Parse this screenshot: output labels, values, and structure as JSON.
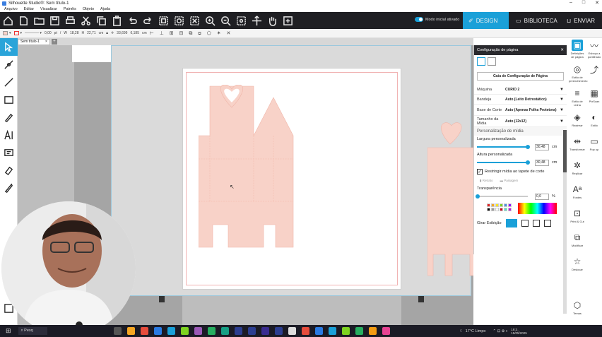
{
  "window": {
    "title": "Silhouette Studio®: Sem título-1",
    "controls": [
      "–",
      "□",
      "✕"
    ]
  },
  "menu": [
    "Arquivo",
    "Editar",
    "Visualizar",
    "Painéis",
    "Objeto",
    "Ajuda"
  ],
  "toolbar": {
    "mode_label": "Modo inicial ativado",
    "tabs": [
      {
        "label": "DESIGN",
        "icon": "design-icon",
        "active": true
      },
      {
        "label": "BIBLIOTECA",
        "icon": "folder-icon",
        "active": false
      },
      {
        "label": "ENVIAR",
        "icon": "send-icon",
        "active": false
      }
    ],
    "accent": "#1aa0d8",
    "dark": "#1f1f23"
  },
  "options_bar": {
    "line_width": "0,00",
    "line_unit": "pt",
    "w_label": "W",
    "w_value": "18,28",
    "h_label": "H",
    "h_value": "22,71",
    "size_unit": "cm",
    "x_value": "33,699",
    "y_value": "6,185",
    "pos_unit": "cm"
  },
  "document": {
    "tab_label": "Sem título-1",
    "close": "×",
    "add": "+"
  },
  "panel": {
    "title": "Configuração de página",
    "guide_button": "Guia de Configuração de Página",
    "rows": [
      {
        "label": "Máquina",
        "value": "CURIO 2"
      },
      {
        "label": "Bandeja",
        "value": "Auto (Leito Detrostático)"
      },
      {
        "label": "Base de Corte",
        "value": "Auto (Apenas Folha Protetora)"
      },
      {
        "label": "Tamanho da Mídia",
        "value": "Auto (12x12)"
      }
    ],
    "section_media": "Personalização de mídia",
    "width_label": "Largura personalizada",
    "width_value": "30,48",
    "height_label": "Altura personalizada",
    "height_value": "30,48",
    "unit": "cm",
    "width_fraction": 1.0,
    "height_fraction": 1.0,
    "restrict_label": "Restringir mídia ao tapete de corte",
    "portrait_label": "Retrato",
    "landscape_label": "Paisagem",
    "transparency_label": "Transparência",
    "transparency_value": "0,0",
    "transparency_unit": "%",
    "rotate_label": "Girar Exibição",
    "colors": [
      "#e02020",
      "#f5a623",
      "#f8e71c",
      "#7ed321",
      "#4a90e2",
      "#9013fe",
      "#000000",
      "#9b9b9b",
      "#ffffff",
      "#d0021b",
      "#50e3c2",
      "#bd10e0"
    ]
  },
  "right_panel": [
    {
      "label": "Definições de página",
      "icon": "page-settings-icon"
    },
    {
      "label": "Esboço a pontilhado",
      "icon": "sketch-icon"
    },
    {
      "label": "Estilo de preenchimento",
      "icon": "fill-style-icon"
    },
    {
      "label": "",
      "icon": "curve-icon"
    },
    {
      "label": "Estilo de Linha",
      "icon": "line-style-icon"
    },
    {
      "label": "PixScan",
      "icon": "pix-icon"
    },
    {
      "label": "Rastrear",
      "icon": "trace-icon"
    },
    {
      "label": "Estilo",
      "icon": "style-icon"
    },
    {
      "label": "Transformar",
      "icon": "transform-icon"
    },
    {
      "label": "Pop up",
      "icon": "popup-icon"
    },
    {
      "label": "Replicar",
      "icon": "replicate-icon"
    },
    {
      "label": "Fontes",
      "icon": "fonts-icon"
    },
    {
      "label": "Print & Cut",
      "icon": "print-cut-icon"
    },
    {
      "label": "Modificar",
      "icon": "modify-icon"
    },
    {
      "label": "Deslocar",
      "icon": "offset-icon"
    },
    {
      "label": "Temas",
      "icon": "themes-icon"
    }
  ],
  "design": {
    "fill": "#f8d2c8",
    "stroke": "#f0b5a8",
    "mat_line": "#f1b3b3"
  },
  "taskbar": {
    "search": "Pesq",
    "weather": "17°C Limpo",
    "time": "19:3_",
    "date": "15/05/2025"
  }
}
